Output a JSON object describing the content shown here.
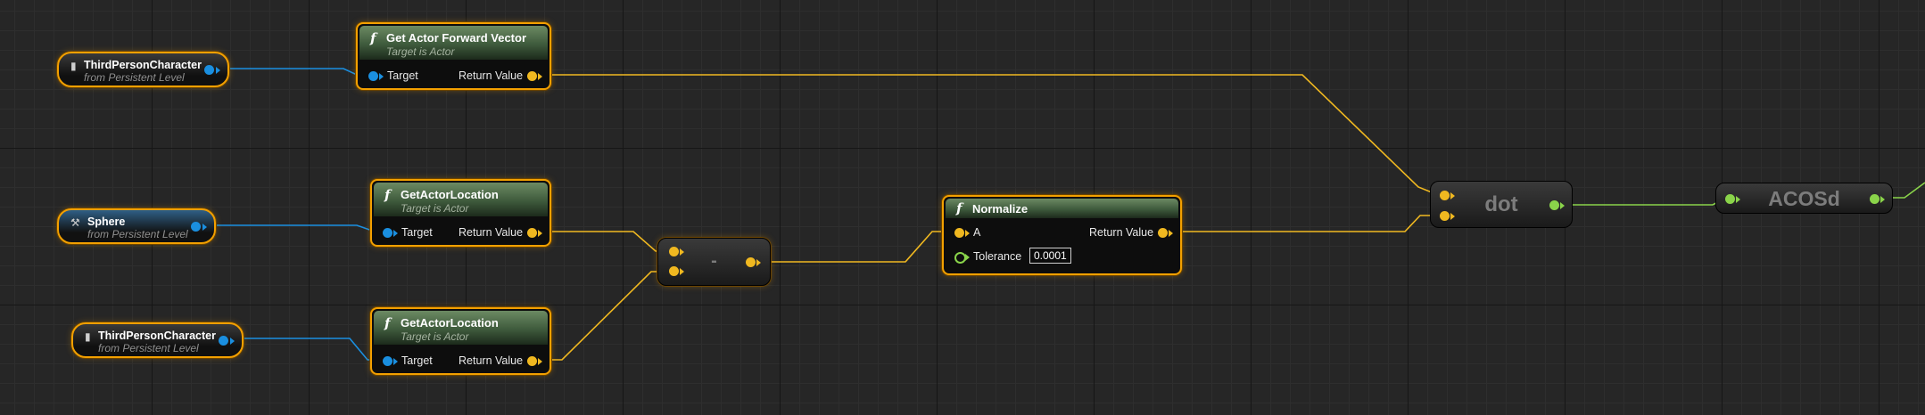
{
  "graph": {
    "nodes": {
      "var_tpc_top": {
        "name": "ThirdPersonCharacter",
        "sub": "from Persistent Level"
      },
      "var_sphere": {
        "name": "Sphere",
        "sub": "from Persistent Level"
      },
      "var_tpc_bottom": {
        "name": "ThirdPersonCharacter",
        "sub": "from Persistent Level"
      },
      "fwd_vector": {
        "title": "Get Actor Forward Vector",
        "sub": "Target is Actor",
        "in_pin": "Target",
        "out_pin": "Return Value"
      },
      "loc_sphere": {
        "title": "GetActorLocation",
        "sub": "Target is Actor",
        "in_pin": "Target",
        "out_pin": "Return Value"
      },
      "loc_tpc": {
        "title": "GetActorLocation",
        "sub": "Target is Actor",
        "in_pin": "Target",
        "out_pin": "Return Value"
      },
      "subtract": {
        "title": "-"
      },
      "normalize": {
        "title": "Normalize",
        "in_pin": "A",
        "out_pin": "Return Value",
        "tol_label": "Tolerance",
        "tol_value": "0.0001"
      },
      "dot": {
        "title": "dot"
      },
      "acos": {
        "title": "ACOSd"
      }
    },
    "colors": {
      "object_pin": "#1a8fe0",
      "vector_pin": "#f0b820",
      "float_pin": "#8ad44a",
      "selection": "#f3a000",
      "function_header": "#4a6a45"
    },
    "icons": {
      "function": "function-f-icon",
      "actor": "actor-pawn-icon",
      "static_mesh": "static-mesh-actor-icon"
    }
  }
}
